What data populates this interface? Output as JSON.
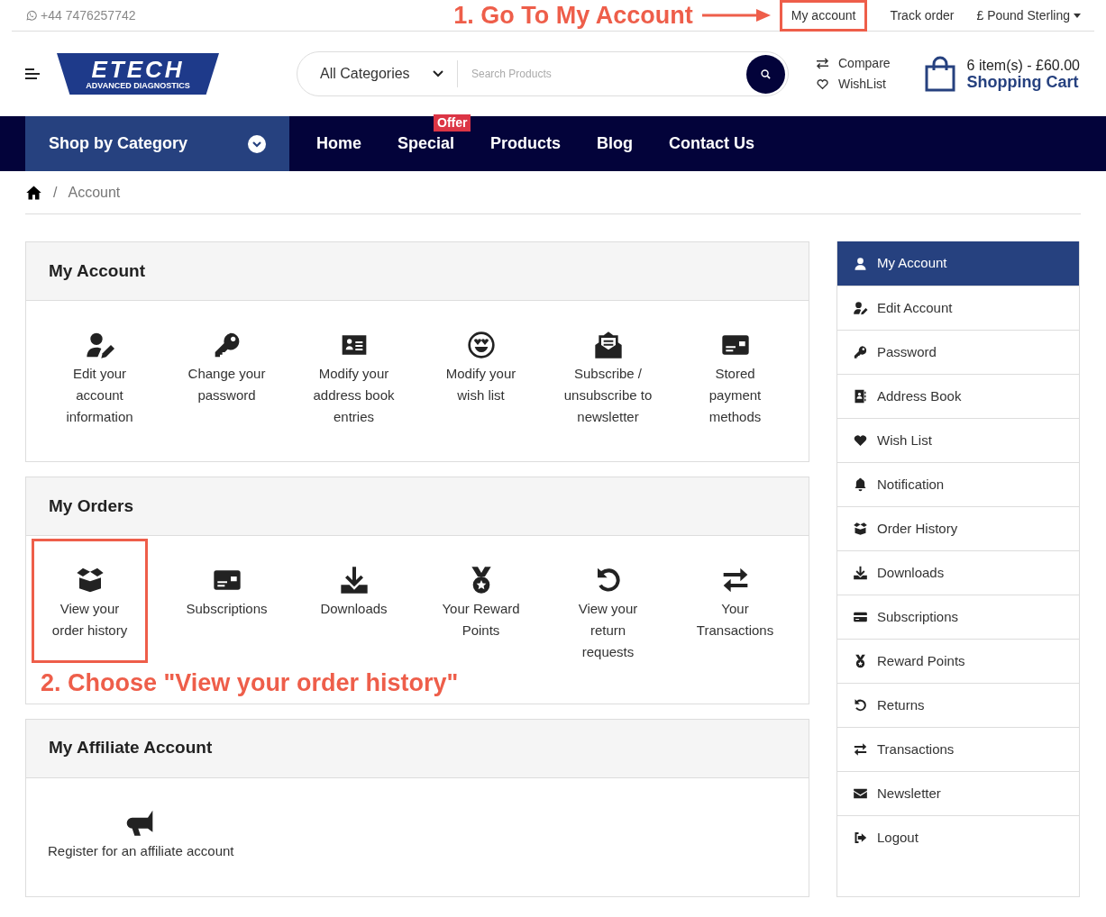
{
  "top_bar": {
    "phone": "+44 7476257742",
    "annotation": "1. Go To My Account",
    "links": [
      {
        "label": "My account",
        "highlighted": true
      },
      {
        "label": "Track order",
        "highlighted": false
      }
    ],
    "currency": "£ Pound Sterling"
  },
  "header": {
    "logo": {
      "wordmark": "ETECH",
      "tagline": "ADVANCED DIAGNOSTICS"
    },
    "search": {
      "category": "All Categories",
      "placeholder": "Search Products"
    },
    "compare": "Compare",
    "wishlist": "WishList",
    "cart": {
      "summary": "6 item(s) - £60.00",
      "label": "Shopping Cart"
    }
  },
  "nav": {
    "category_menu": "Shop by Category",
    "items": [
      {
        "label": "Home"
      },
      {
        "label": "Special",
        "badge": "Offer"
      },
      {
        "label": "Products"
      },
      {
        "label": "Blog"
      },
      {
        "label": "Contact Us"
      }
    ]
  },
  "breadcrumb": [
    {
      "separator": "/",
      "label": "Account"
    }
  ],
  "sections": [
    {
      "title": "My Account",
      "items": [
        {
          "label": "Edit your account information",
          "highlighted": false
        },
        {
          "label": "Change your password",
          "highlighted": false
        },
        {
          "label": "Modify your address book entries",
          "highlighted": false
        },
        {
          "label": "Modify your wish list",
          "highlighted": false
        },
        {
          "label": "Subscribe / unsubscribe to newsletter",
          "highlighted": false
        },
        {
          "label": "Stored payment methods",
          "highlighted": false
        }
      ]
    },
    {
      "title": "My Orders",
      "annotation": "2. Choose \"View your order history\"",
      "items": [
        {
          "label": "View your order history",
          "highlighted": true
        },
        {
          "label": "Subscriptions",
          "highlighted": false
        },
        {
          "label": "Downloads",
          "highlighted": false
        },
        {
          "label": "Your Reward Points",
          "highlighted": false
        },
        {
          "label": "View your return requests",
          "highlighted": false
        },
        {
          "label": "Your Transactions",
          "highlighted": false
        }
      ]
    },
    {
      "title": "My Affiliate Account",
      "items": [
        {
          "label": "Register for an affiliate account",
          "highlighted": false
        }
      ]
    }
  ],
  "sidebar": {
    "items": [
      {
        "label": "My Account",
        "selected": true
      },
      {
        "label": "Edit Account",
        "selected": false
      },
      {
        "label": "Password",
        "selected": false
      },
      {
        "label": "Address Book",
        "selected": false
      },
      {
        "label": "Wish List",
        "selected": false
      },
      {
        "label": "Notification",
        "selected": false
      },
      {
        "label": "Order History",
        "selected": false
      },
      {
        "label": "Downloads",
        "selected": false
      },
      {
        "label": "Subscriptions",
        "selected": false
      },
      {
        "label": "Reward Points",
        "selected": false
      },
      {
        "label": "Returns",
        "selected": false
      },
      {
        "label": "Transactions",
        "selected": false
      },
      {
        "label": "Newsletter",
        "selected": false
      },
      {
        "label": "Logout",
        "selected": false
      }
    ]
  }
}
